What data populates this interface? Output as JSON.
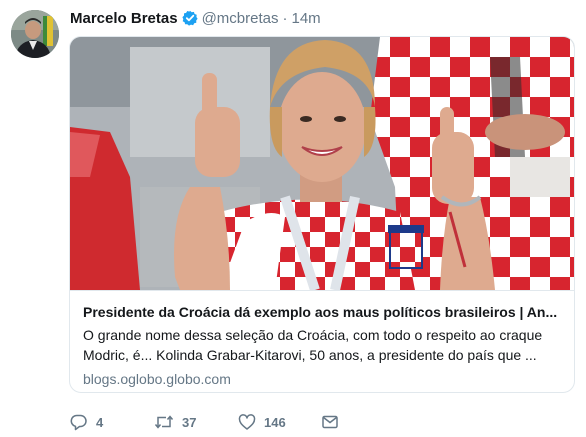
{
  "tweet": {
    "display_name": "Marcelo Bretas",
    "handle": "@mcbretas",
    "separator": "·",
    "time": "14m",
    "avatar_icon": "user-avatar",
    "verified_icon": "verified-badge-icon"
  },
  "card": {
    "title": "Presidente da Croácia dá exemplo aos maus políticos brasileiros | An...",
    "description": "O grande nome dessa seleção da Croácia, com todo o respeito ao craque Modric, é... Kolinda Grabar-Kitarovi, 50 anos, a presidente do país que ...",
    "url": "blogs.oglobo.globo.com",
    "image_icon": "article-photo"
  },
  "actions": {
    "reply_count": "4",
    "retweet_count": "37",
    "like_count": "146",
    "reply_icon": "reply-icon",
    "retweet_icon": "retweet-icon",
    "like_icon": "heart-icon",
    "message_icon": "envelope-icon"
  },
  "colors": {
    "text": "#14171a",
    "secondary": "#657786",
    "verified": "#1da1f2",
    "border": "#e1e8ed",
    "croatia_red": "#d7252f"
  }
}
